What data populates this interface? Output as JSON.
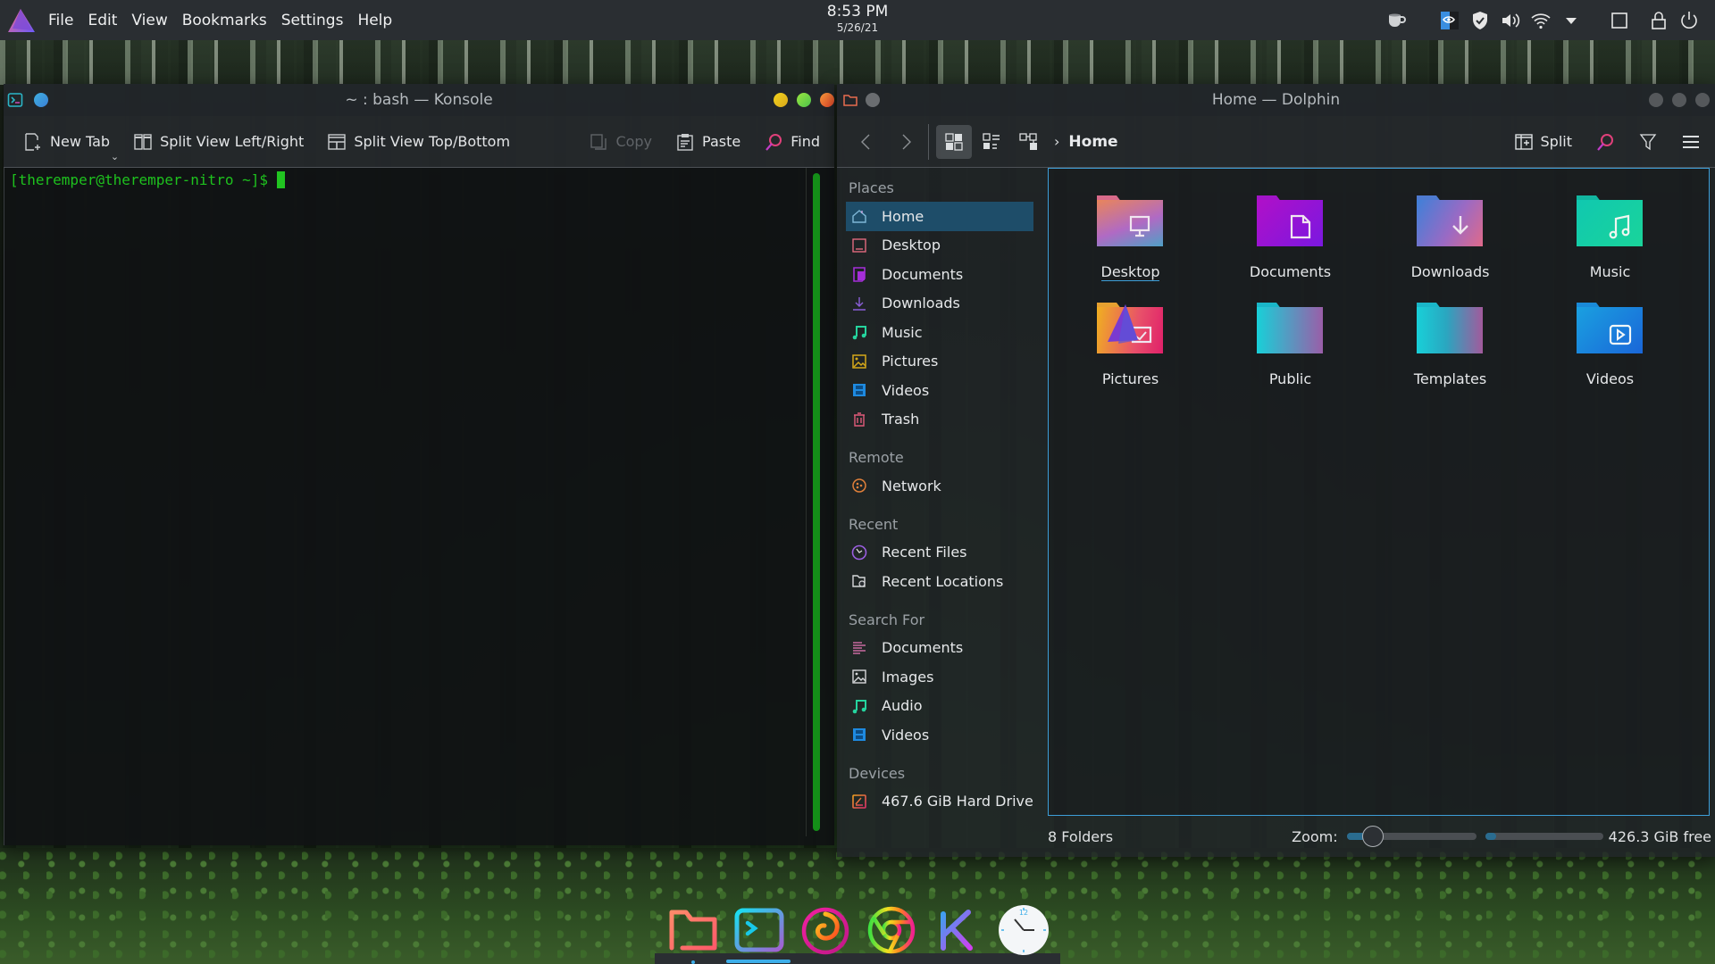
{
  "top_panel": {
    "menus": [
      "File",
      "Edit",
      "View",
      "Bookmarks",
      "Settings",
      "Help"
    ],
    "clock": {
      "time": "8:53 PM",
      "date": "5/26/21"
    },
    "tray_icons": [
      "caffeine-cup-icon",
      "nvidia-icon",
      "shield-check-icon",
      "volume-icon",
      "wifi-icon",
      "tray-expand-arrow-icon",
      "show-desktop-icon",
      "lock-icon",
      "power-icon"
    ]
  },
  "konsole": {
    "title": "~ : bash — Konsole",
    "toolbar": {
      "new_tab": "New Tab",
      "split_lr": "Split View Left/Right",
      "split_tb": "Split View Top/Bottom",
      "copy": "Copy",
      "paste": "Paste",
      "find": "Find"
    },
    "prompt": "[theremper@theremper-nitro ~]$",
    "colors": {
      "prompt": "#1ec21e",
      "scrollbar": "#158f19"
    }
  },
  "dolphin": {
    "title": "Home — Dolphin",
    "breadcrumb": "Home",
    "toolbar": {
      "split": "Split"
    },
    "sidebar": {
      "sections": [
        {
          "title": "Places",
          "items": [
            {
              "label": "Home",
              "icon": "home-icon",
              "active": true
            },
            {
              "label": "Desktop",
              "icon": "desktop-icon"
            },
            {
              "label": "Documents",
              "icon": "documents-icon"
            },
            {
              "label": "Downloads",
              "icon": "downloads-icon"
            },
            {
              "label": "Music",
              "icon": "music-icon"
            },
            {
              "label": "Pictures",
              "icon": "pictures-icon"
            },
            {
              "label": "Videos",
              "icon": "videos-icon"
            },
            {
              "label": "Trash",
              "icon": "trash-icon"
            }
          ]
        },
        {
          "title": "Remote",
          "items": [
            {
              "label": "Network",
              "icon": "network-icon"
            }
          ]
        },
        {
          "title": "Recent",
          "items": [
            {
              "label": "Recent Files",
              "icon": "recent-files-icon"
            },
            {
              "label": "Recent Locations",
              "icon": "recent-locations-icon"
            }
          ]
        },
        {
          "title": "Search For",
          "items": [
            {
              "label": "Documents",
              "icon": "search-documents-icon"
            },
            {
              "label": "Images",
              "icon": "search-images-icon"
            },
            {
              "label": "Audio",
              "icon": "search-audio-icon"
            },
            {
              "label": "Videos",
              "icon": "search-videos-icon"
            }
          ]
        },
        {
          "title": "Devices",
          "items": [
            {
              "label": "467.6 GiB Hard Drive",
              "icon": "hard-drive-icon"
            }
          ]
        }
      ]
    },
    "folders": [
      {
        "label": "Desktop",
        "icon": "folder-desktop-icon"
      },
      {
        "label": "Documents",
        "icon": "folder-documents-icon"
      },
      {
        "label": "Downloads",
        "icon": "folder-downloads-icon"
      },
      {
        "label": "Music",
        "icon": "folder-music-icon"
      },
      {
        "label": "Pictures",
        "icon": "folder-pictures-icon"
      },
      {
        "label": "Public",
        "icon": "folder-public-icon"
      },
      {
        "label": "Templates",
        "icon": "folder-templates-icon"
      },
      {
        "label": "Videos",
        "icon": "folder-videos-icon"
      }
    ],
    "status": {
      "count": "8 Folders",
      "zoom_label": "Zoom:",
      "zoom_fraction": 0.2,
      "disk_used_fraction": 0.09,
      "free": "426.3 GiB free"
    },
    "accent": "#3daee9"
  },
  "dock": {
    "apps": [
      "dolphin-folder-icon",
      "konsole-terminal-icon",
      "firefox-icon",
      "chrome-icon",
      "kde-k-icon",
      "clock-widget-icon"
    ]
  }
}
